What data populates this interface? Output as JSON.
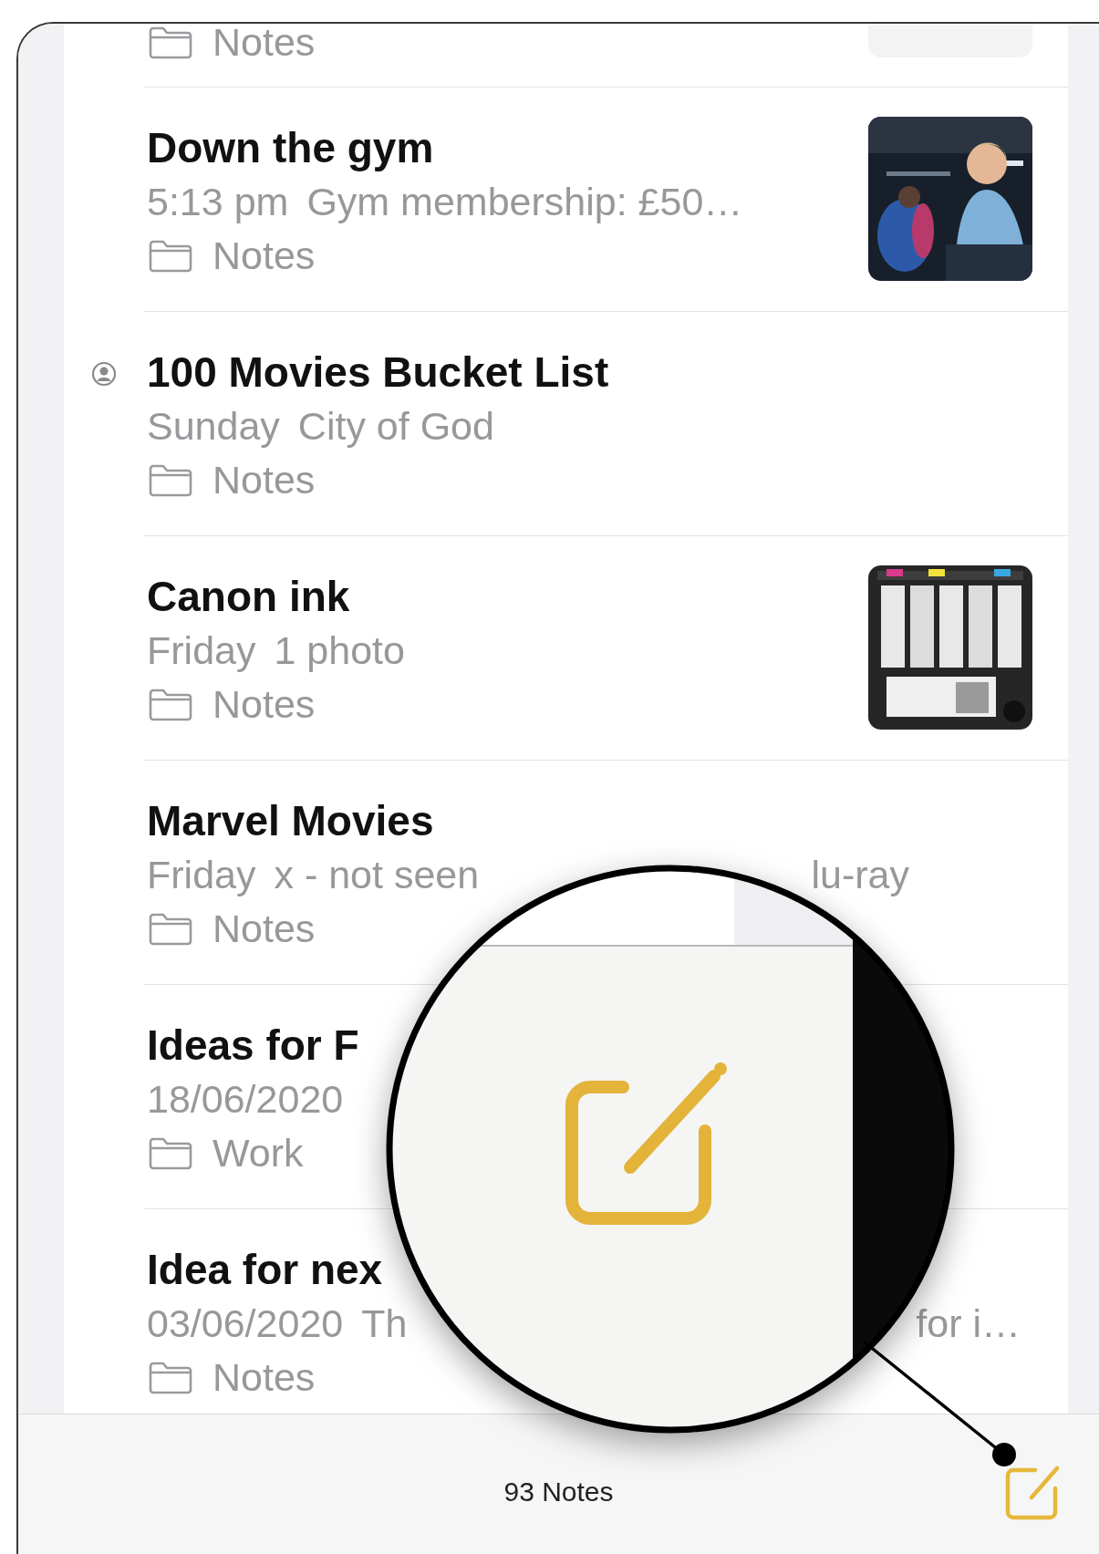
{
  "notes": [
    {
      "folder": "Notes",
      "thumbnail": {
        "kind": "placeholder"
      }
    },
    {
      "title": "Down the gym",
      "shared": false,
      "date": "5:13 pm",
      "preview": "Gym membership: £50…",
      "folder": "Notes"
    },
    {
      "title": "100 Movies Bucket List",
      "shared": true,
      "date": "Sunday",
      "preview": "City of God",
      "folder": "Notes"
    },
    {
      "title": "Canon ink",
      "shared": false,
      "date": "Friday",
      "preview": "1 photo",
      "folder": "Notes"
    },
    {
      "title": "Marvel Movies",
      "shared": false,
      "date": "Friday",
      "preview": "x - not seen",
      "preview_tail": "lu-ray",
      "folder": "Notes"
    },
    {
      "title": "Ideas for F",
      "shared": false,
      "date": "18/06/2020",
      "folder": "Work"
    },
    {
      "title": "Idea for nex",
      "shared": false,
      "date": "03/06/2020",
      "preview": "Th",
      "preview_tail": "for i…",
      "folder": "Notes"
    }
  ],
  "toolbar": {
    "count": "93 Notes"
  }
}
